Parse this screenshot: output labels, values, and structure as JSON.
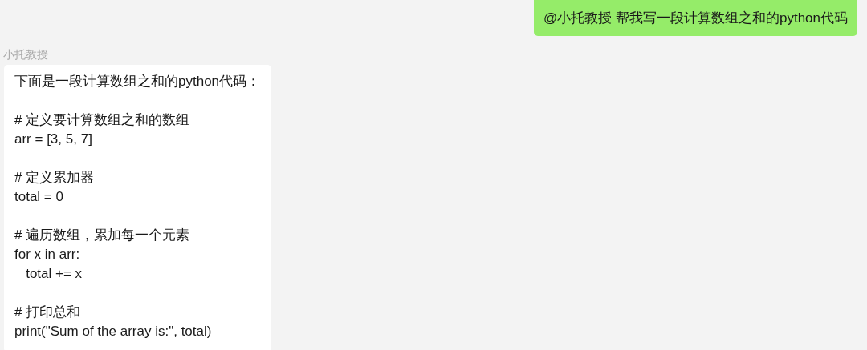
{
  "messages": [
    {
      "kind": "sent",
      "text": "@小托教授 帮我写一段计算数组之和的python代码"
    },
    {
      "kind": "received",
      "sender": "小托教授",
      "intro": "下面是一段计算数组之和的python代码：",
      "code_blocks": [
        [
          "# 定义要计算数组之和的数组",
          "arr = [3, 5, 7]"
        ],
        [
          "# 定义累加器",
          "total = 0"
        ],
        [
          "# 遍历数组，累加每一个元素",
          "for x in arr:",
          "   total += x"
        ],
        [
          "# 打印总和",
          "print(\"Sum of the array is:\", total)"
        ]
      ]
    }
  ]
}
